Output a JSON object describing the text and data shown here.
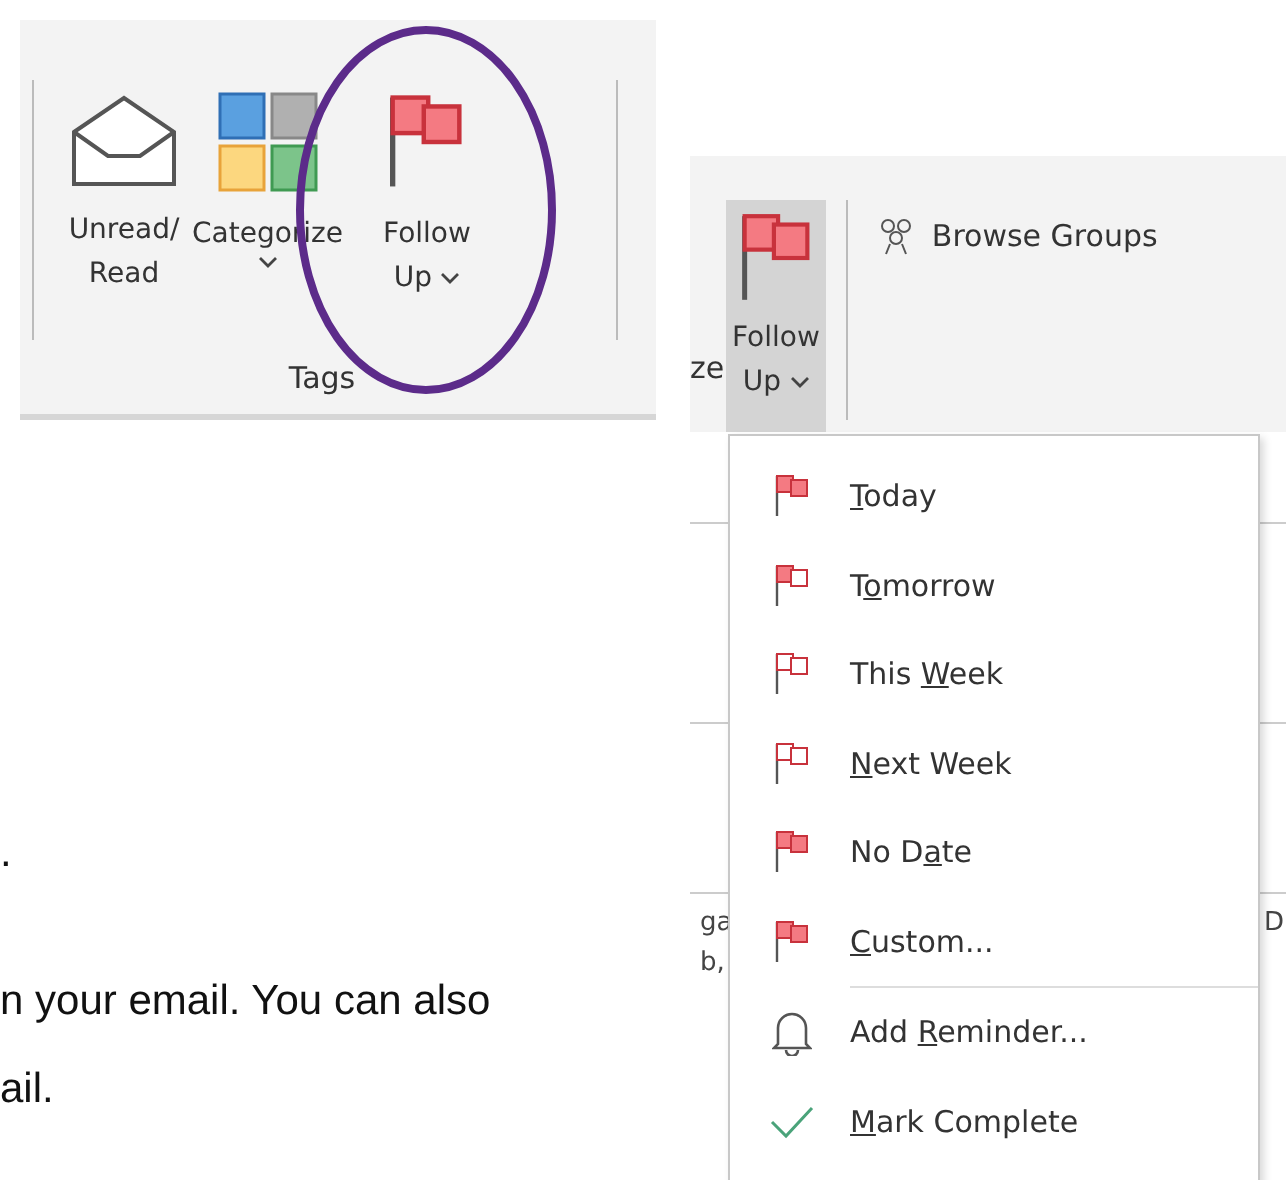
{
  "tags_ribbon": {
    "buttons": [
      {
        "kind": "envelope",
        "lines": [
          "Unread/",
          "Read"
        ],
        "dropdown": false
      },
      {
        "kind": "categories",
        "lines": [
          "Categorize"
        ],
        "dropdown": true
      },
      {
        "kind": "flag",
        "lines": [
          "Follow",
          "Up"
        ],
        "dropdown": true
      }
    ],
    "annotation_ellipse": true,
    "group_label": "Tags"
  },
  "groups_ribbon": {
    "cut_label": "ze",
    "follow_up": {
      "lines": [
        "Follow",
        "Up"
      ],
      "dropdown": true,
      "selected": true
    },
    "browse_groups": "Browse Groups"
  },
  "follow_up_menu": {
    "items": [
      {
        "kind": "flag-full",
        "key": "T",
        "post": "oday",
        "separator_before": false
      },
      {
        "kind": "flag-half",
        "pre": "T",
        "key": "o",
        "post": "morrow",
        "separator_before": false
      },
      {
        "kind": "flag-empty",
        "pre": "This ",
        "key": "W",
        "post": "eek",
        "separator_before": false
      },
      {
        "kind": "flag-empty",
        "key": "N",
        "post": "ext Week",
        "separator_before": false
      },
      {
        "kind": "flag-full",
        "pre": "No D",
        "key": "a",
        "post": "te",
        "separator_before": false
      },
      {
        "kind": "flag-full",
        "key": "C",
        "post": "ustom...",
        "separator_before": false
      },
      {
        "kind": "bell",
        "pre": "Add ",
        "key": "R",
        "post": "eminder...",
        "separator_before": true
      },
      {
        "kind": "check",
        "key": "M",
        "post": "ark Complete",
        "separator_before": false
      }
    ]
  },
  "document_lines": [
    ".",
    "n your email. You can also",
    "ail."
  ],
  "background_fragments": [
    "ga",
    "b,",
    "D"
  ]
}
